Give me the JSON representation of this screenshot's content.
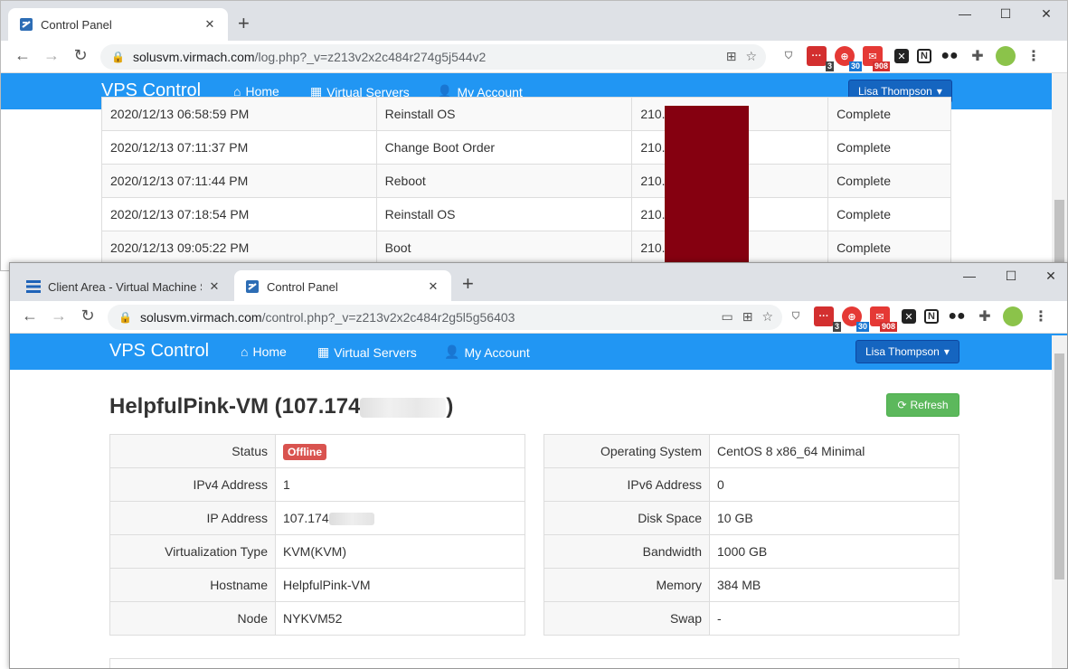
{
  "back_window": {
    "tab_title": "Control Panel",
    "url_host": "solusvm.virmach.com",
    "url_path": "/log.php?_v=z213v2x2c484r274g5j544v2",
    "log_rows": [
      {
        "date": "2020/12/13 06:58:59 PM",
        "action": "Reinstall OS",
        "ip": "210.",
        "status": "Complete"
      },
      {
        "date": "2020/12/13 07:11:37 PM",
        "action": "Change Boot Order",
        "ip": "210.",
        "status": "Complete"
      },
      {
        "date": "2020/12/13 07:11:44 PM",
        "action": "Reboot",
        "ip": "210.",
        "status": "Complete"
      },
      {
        "date": "2020/12/13 07:18:54 PM",
        "action": "Reinstall OS",
        "ip": "210.",
        "status": "Complete"
      },
      {
        "date": "2020/12/13 09:05:22 PM",
        "action": "Boot",
        "ip": "210.",
        "status": "Complete"
      }
    ]
  },
  "front_window": {
    "tabs": [
      {
        "title": "Client Area - Virtual Machine S"
      },
      {
        "title": "Control Panel"
      }
    ],
    "url_host": "solusvm.virmach.com",
    "url_path": "/control.php?_v=z213v2x2c484r2g5l5g56403"
  },
  "extensions": {
    "badges": [
      "3",
      "30",
      "908"
    ]
  },
  "nav": {
    "brand": "VPS Control",
    "home": "Home",
    "servers": "Virtual Servers",
    "account": "My Account",
    "user": "Lisa Thompson"
  },
  "vm": {
    "title_prefix": "HelpfulPink-VM (107.174",
    "title_suffix": ")",
    "refresh_label": "Refresh",
    "left": [
      {
        "label": "Status",
        "value": "Offline"
      },
      {
        "label": "IPv4 Address",
        "value": "1"
      },
      {
        "label": "IP Address",
        "value": "107.174"
      },
      {
        "label": "Virtualization Type",
        "value": "KVM(KVM)"
      },
      {
        "label": "Hostname",
        "value": "HelpfulPink-VM"
      },
      {
        "label": "Node",
        "value": "NYKVM52"
      }
    ],
    "right": [
      {
        "label": "Operating System",
        "value": "CentOS 8 x86_64 Minimal"
      },
      {
        "label": "IPv6 Address",
        "value": "0"
      },
      {
        "label": "Disk Space",
        "value": "10 GB"
      },
      {
        "label": "Bandwidth",
        "value": "1000 GB"
      },
      {
        "label": "Memory",
        "value": "384 MB"
      },
      {
        "label": "Swap",
        "value": "-"
      }
    ]
  },
  "colors": {
    "nav_blue": "#2196f3",
    "user_button": "#1565c0",
    "offline_red": "#d9534f",
    "refresh_green": "#5cb85c",
    "redaction": "#850010"
  }
}
